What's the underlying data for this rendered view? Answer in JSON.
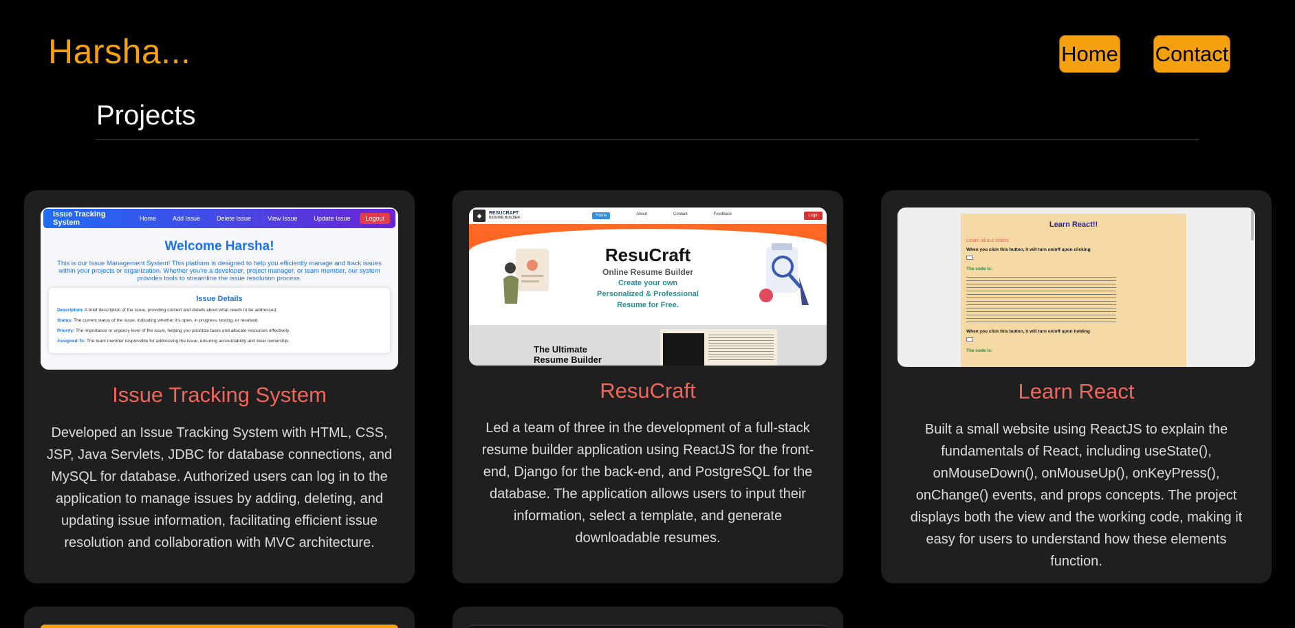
{
  "header": {
    "brand": "Harsha...",
    "nav": {
      "home": "Home",
      "contact": "Contact"
    }
  },
  "section": {
    "title": "Projects"
  },
  "projects": [
    {
      "title": "Issue Tracking System",
      "description": "Developed an Issue Tracking System with HTML, CSS, JSP, Java Servlets, JDBC for database connections, and MySQL for database. Authorized users can log in to the application to manage issues by adding, deleting, and updating issue information, facilitating efficient issue resolution and collaboration with MVC architecture.",
      "thumb": {
        "brand": "Issue Tracking System",
        "links": [
          "Home",
          "Add Issue",
          "Delete Issue",
          "View Issue",
          "Update Issue"
        ],
        "logout": "Logout",
        "welcome": "Welcome Harsha!",
        "intro": "This is our Issue Management System! This platform is designed to help you efficiently manage and track issues within your projects or organization. Whether you're a developer, project manager, or team member, our system provides tools to streamline the issue resolution process.",
        "box_title": "Issue Details",
        "rows": [
          {
            "label": "Description:",
            "text": " A brief description of the issue, providing context and details about what needs to be addressed."
          },
          {
            "label": "Status:",
            "text": " The current status of the issue, indicating whether it's open, in progress, testing, or resolved."
          },
          {
            "label": "Priority:",
            "text": " The importance or urgency level of the issue, helping you prioritize tasks and allocate resources effectively."
          },
          {
            "label": "Assigned To:",
            "text": " The team member responsible for addressing the issue, ensuring accountability and clear ownership."
          }
        ]
      }
    },
    {
      "title": "ResuCraft",
      "description": "Led a team of three in the development of a full-stack resume builder application using ReactJS for the front-end, Django for the back-end, and PostgreSQL for the database. The application allows users to input their information, select a template, and generate downloadable resumes.",
      "thumb": {
        "logo_line1": "RESUCRAFT",
        "logo_line2": "RESUME BUILDER",
        "links": [
          "Home",
          "About",
          "Contact",
          "Feedback"
        ],
        "login": "Login",
        "hero_title": "ResuCraft",
        "hero_sub": "Online Resume Builder",
        "hero_tag1": "Create your own",
        "hero_tag2": "Personalized & Professional",
        "hero_tag3": "Resume for Free.",
        "ultimate1": "The Ultimate",
        "ultimate2": "Resume Builder"
      }
    },
    {
      "title": "Learn React",
      "description": "Built a small website using ReactJS to explain the fundamentals of React, including useState(), onMouseDown(), onMouseUp(), onKeyPress(), onChange() events, and props concepts. The project displays both the view and the working code, making it easy for users to understand how these elements function.",
      "thumb": {
        "heading": "Learn React!!",
        "sub": "Learn about states",
        "line1": "When you click this button, it will turn on/off upon clicking",
        "code_label": "The code is:",
        "line2": "When you click this button, it will turn on/off upon holding",
        "code_label2": "The code is:"
      }
    }
  ],
  "colors": {
    "accent": "#f5a10f",
    "card_title": "#f0665a",
    "card_bg": "#1f1f1f"
  }
}
